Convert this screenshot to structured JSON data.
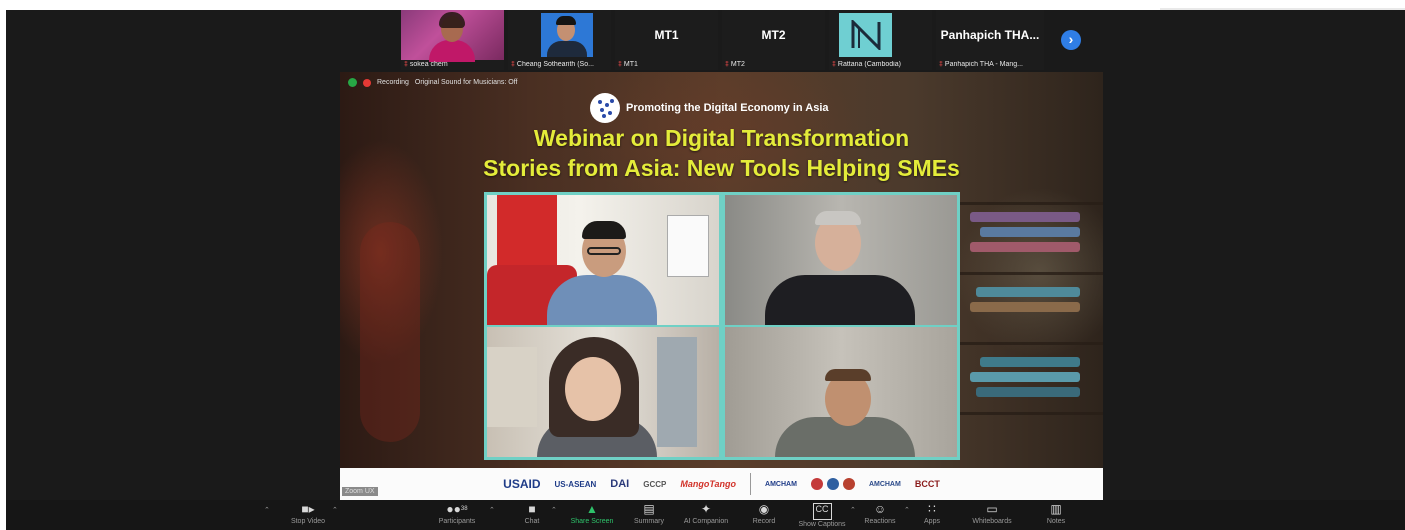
{
  "participants": [
    {
      "label": "",
      "name": "sokea chem"
    },
    {
      "label": "",
      "name": "Cheang Sothearith (So..."
    },
    {
      "label": "MT1",
      "name": "MT1"
    },
    {
      "label": "MT2",
      "name": "MT2"
    },
    {
      "label": "",
      "name": "Rattana (Cambodia)"
    },
    {
      "label": "Panhapich THA...",
      "name": "Panhapich THA - Mang..."
    }
  ],
  "next_icon": "chevron-right-icon",
  "recording": {
    "label": "Recording",
    "sound": "Original Sound for Musicians: Off"
  },
  "slide": {
    "subtitle": "Promoting the Digital Economy in Asia",
    "title_line1": "Webinar on Digital Transformation",
    "title_line2": "Stories from Asia: New Tools Helping SMEs",
    "title_color": "#e4ec3a",
    "grid_border_color": "#6fd0c5",
    "sponsors": [
      "USAID",
      "US-ASEAN",
      "DAI",
      "GCCP",
      "MangoTango",
      "AMCHAM",
      "AMCHAM",
      "BCCT"
    ]
  },
  "zoom_tag": "Zoom UX",
  "toolbar": {
    "stop_video": "Stop Video",
    "participants": "Participants",
    "participants_count": "38",
    "chat": "Chat",
    "share_screen": "Share Screen",
    "summary": "Summary",
    "ai_companion": "AI Companion",
    "record": "Record",
    "show_captions": "Show Captions",
    "reactions": "Reactions",
    "apps": "Apps",
    "whiteboards": "Whiteboards",
    "notes": "Notes",
    "accent_green": "#2ec26a"
  }
}
